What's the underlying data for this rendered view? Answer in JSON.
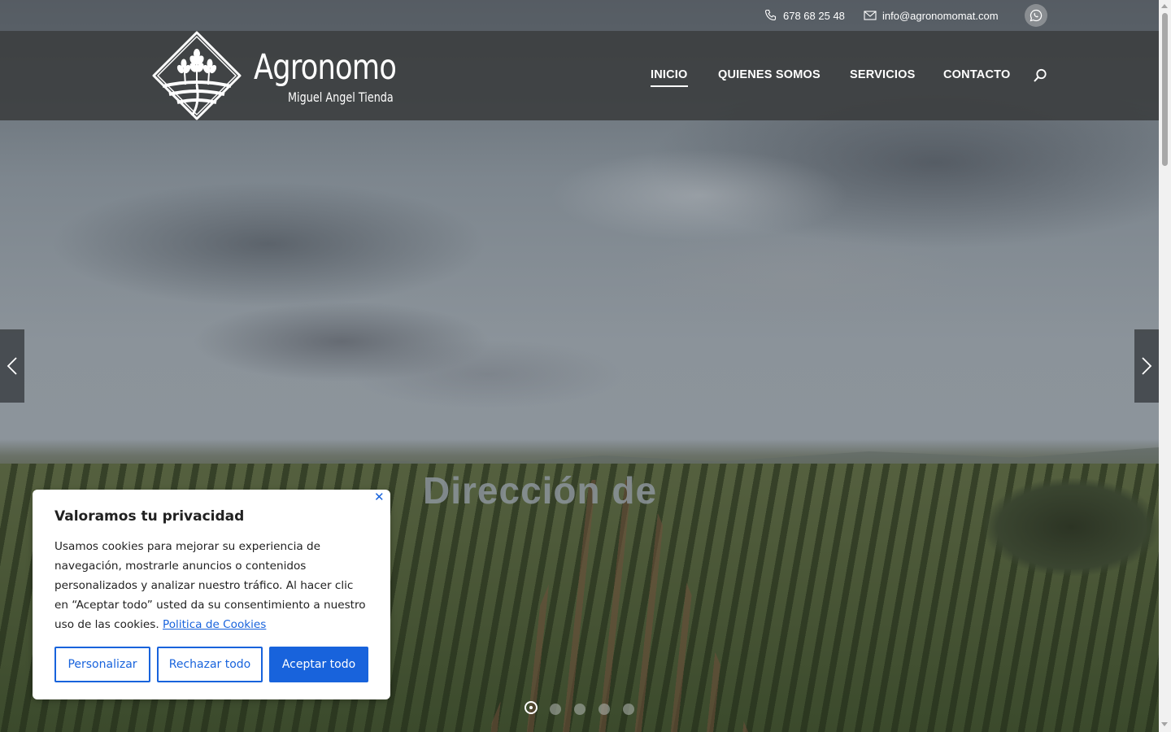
{
  "topbar": {
    "phone": "678 68 25 48",
    "email": "info@agronomomat.com",
    "phone_icon": "phone-icon",
    "email_icon": "mail-icon",
    "whatsapp_icon": "whatsapp-icon"
  },
  "logo": {
    "brand": "Agronomo",
    "subtitle": "Miguel Angel Tienda"
  },
  "nav": {
    "items": [
      {
        "label": "INICIO",
        "active": true
      },
      {
        "label": "QUIENES SOMOS",
        "active": false
      },
      {
        "label": "SERVICIOS",
        "active": false
      },
      {
        "label": "CONTACTO",
        "active": false
      }
    ],
    "search_icon": "search-icon"
  },
  "hero": {
    "title": "Dirección de",
    "slides_count": 5,
    "active_slide": 1
  },
  "cookie_banner": {
    "title": "Valoramos tu privacidad",
    "text": "Usamos cookies para mejorar su experiencia de navegación, mostrarle anuncios o contenidos personalizados y analizar nuestro tráfico. Al hacer clic en “Aceptar todo” usted da su consentimiento a nuestro uso de las cookies.",
    "policy_link": "Politica de Cookies",
    "buttons": {
      "customize": "Personalizar",
      "reject": "Rechazar todo",
      "accept": "Aceptar todo"
    },
    "accent_color": "#1863dc"
  }
}
